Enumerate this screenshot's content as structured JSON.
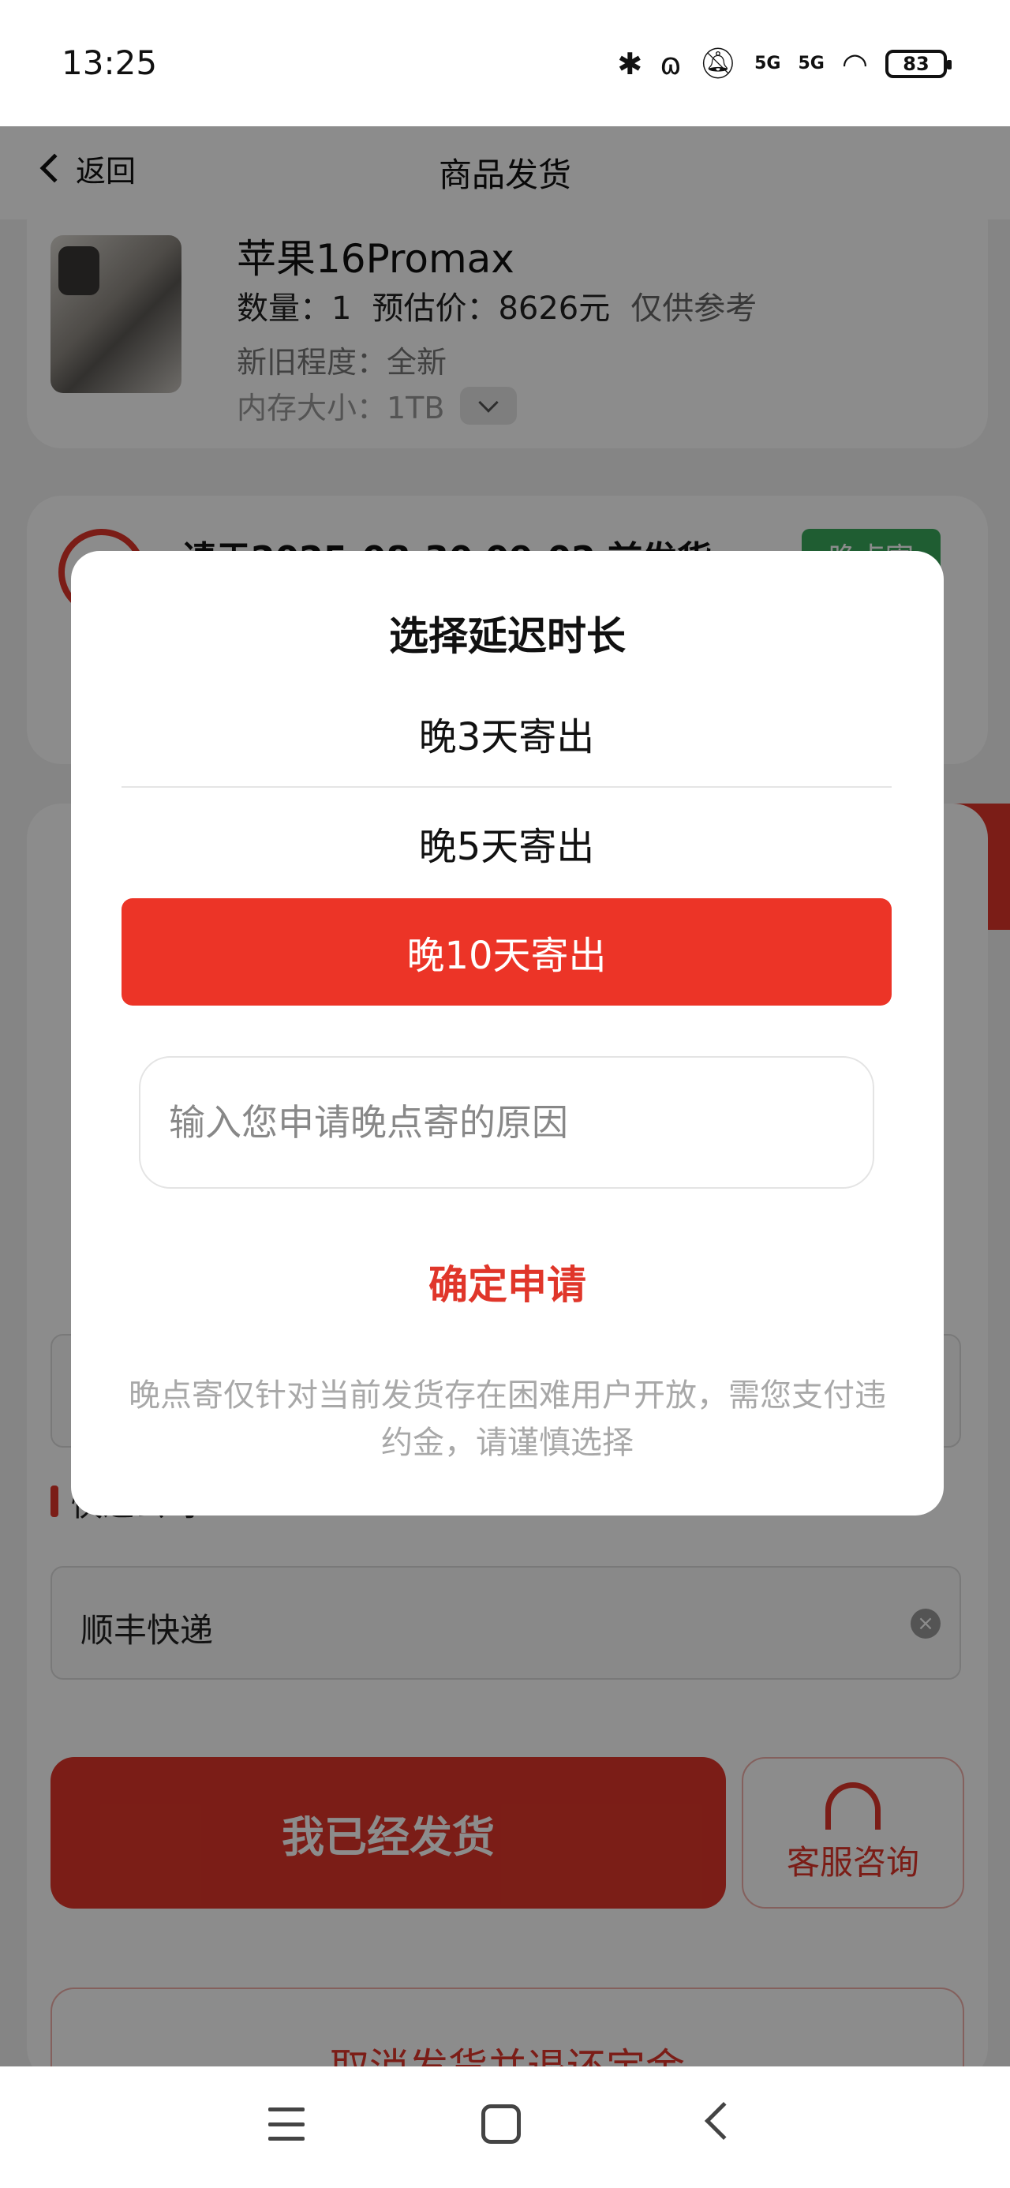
{
  "status_bar": {
    "time": "13:25",
    "battery": "83",
    "signal_1": "5G",
    "signal_2": "5G",
    "icons": [
      "bluetooth-icon",
      "earbuds-icon",
      "mute-bell-icon",
      "signal-5g-icon",
      "signal-5g-icon",
      "wifi-icon",
      "battery-icon"
    ]
  },
  "navbar": {
    "back_label": "返回",
    "title": "商品发货"
  },
  "product": {
    "name": "苹果16Promax",
    "quantity_label": "数量：1",
    "price_label": "预估价：8626元",
    "price_note": "仅供参考",
    "condition": "新旧程度：全新",
    "memory": "内存大小：1TB"
  },
  "deadline": {
    "text": "请于2025-08-30 09:02 前发货",
    "late_badge": "晚点寄"
  },
  "form": {
    "courier_label": "快递公司",
    "courier_value": "顺丰快递"
  },
  "actions": {
    "shipped": "我已经发货",
    "service": "客服咨询",
    "cancel": "取消发货并退还定金"
  },
  "dialog": {
    "title": "选择延迟时长",
    "options": [
      "晚3天寄出",
      "晚5天寄出",
      "晚10天寄出"
    ],
    "selected_option": "晚10天寄出",
    "reason_placeholder": "输入您申请晚点寄的原因",
    "confirm": "确定申请",
    "note": "晚点寄仅针对当前发货存在困难用户开放，需您支付违约金，请谨慎选择"
  },
  "colors": {
    "accent_red": "#ec3427",
    "badge_green": "#3aaa5c"
  }
}
